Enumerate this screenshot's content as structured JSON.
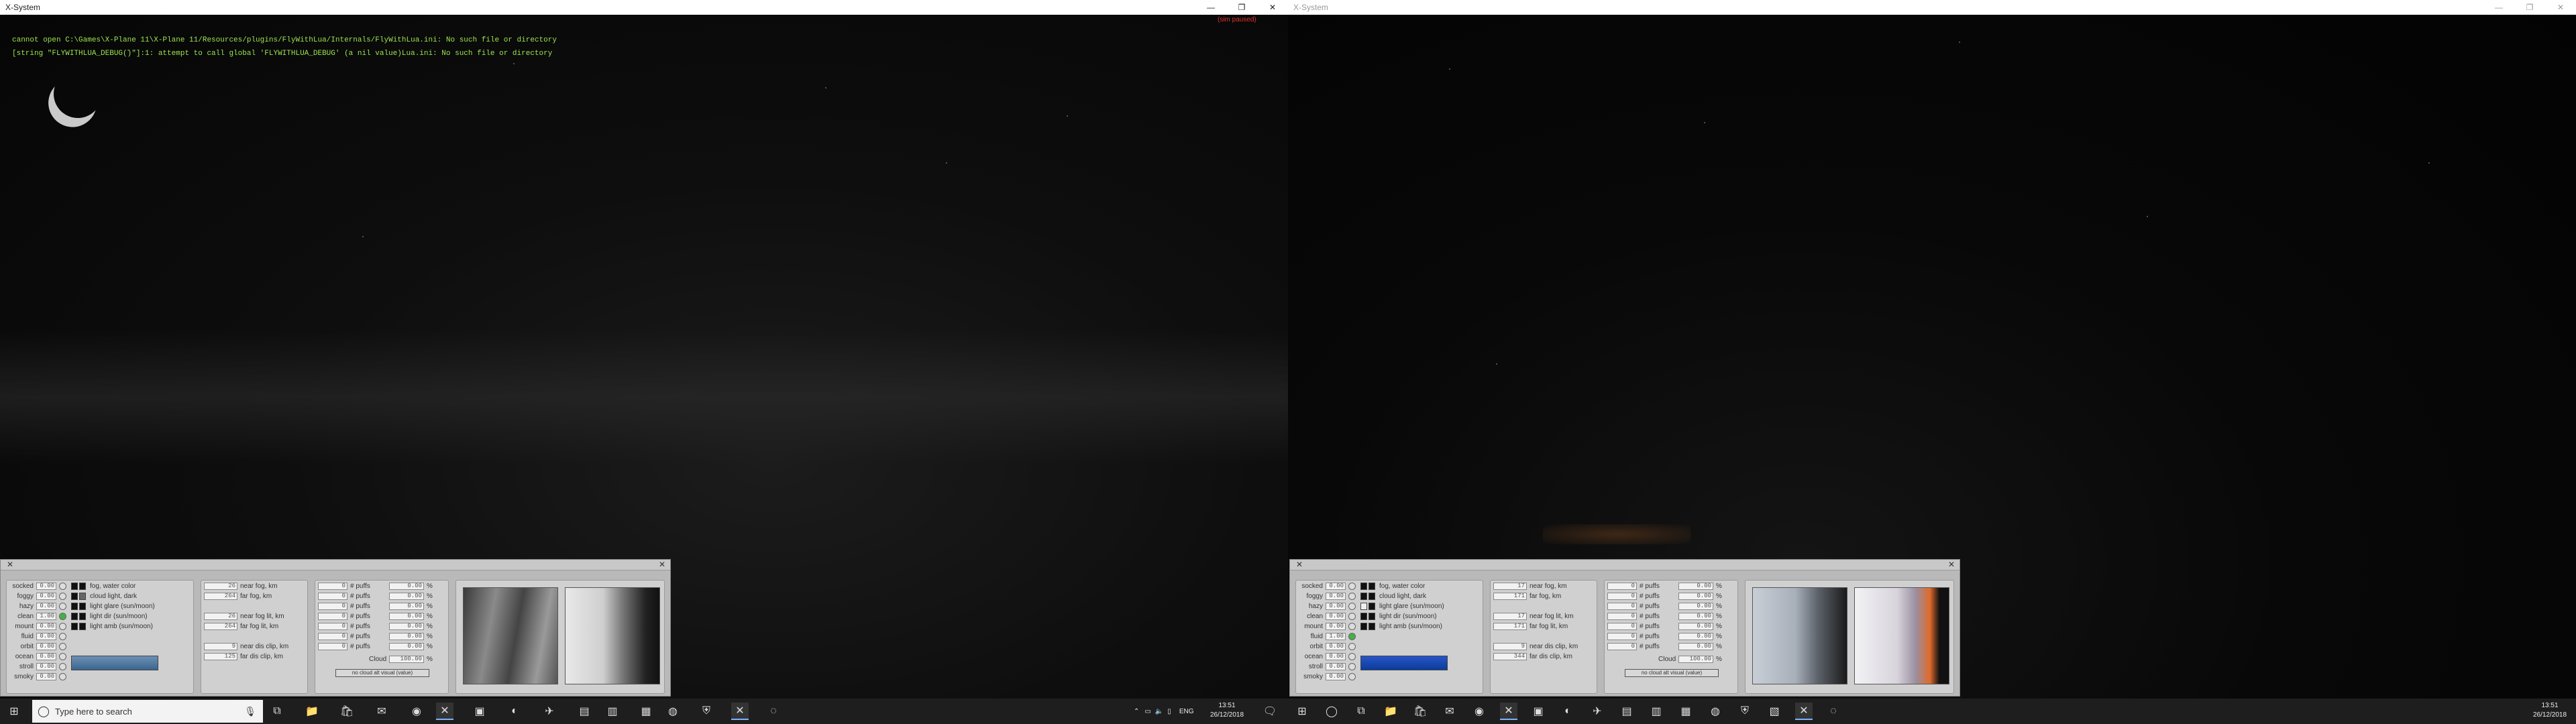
{
  "left_window": {
    "title": "X-System",
    "controls": [
      "—",
      "❐",
      "✕"
    ],
    "console_lines": [
      "cannot open C:\\Games\\X-Plane 11\\X-Plane 11/Resources/plugins/FlyWithLua/Internals/FlyWithLua.ini: No such file or directory",
      "[string \"FLYWITHLUA_DEBUG()\"]:1: attempt to call global 'FLYWITHLUA_DEBUG' (a nil value)Lua.ini: No such file or directory"
    ],
    "paused_text": "(sim paused)",
    "panel": {
      "weather_labels": [
        "socked",
        "foggy",
        "hazy",
        "clean",
        "mount",
        "fluid",
        "orbit",
        "ocean",
        "stroll",
        "smoky"
      ],
      "weather_values": [
        "0.00",
        "0.00",
        "0.00",
        "1.00",
        "0.00",
        "0.00",
        "0.00",
        "0.00",
        "0.00",
        "0.00"
      ],
      "color_labels": [
        "fog, water color",
        "cloud light, dark",
        "light glare (sun/moon)",
        "light dir (sun/moon)",
        "light amb (sun/moon)"
      ],
      "fog_values": [
        "26",
        "264",
        "",
        "26",
        "264",
        "",
        "9",
        "125"
      ],
      "fog_labels": [
        "near fog, km",
        "far fog, km",
        "",
        "near fog lit, km",
        "far fog lit, km",
        "",
        "near dis clip, km",
        "far dis clip, km"
      ],
      "puff_values": [
        "0",
        "0",
        "0",
        "0",
        "0",
        "0",
        "0"
      ],
      "puff_pct": [
        "0.00",
        "0.00",
        "0.00",
        "0.00",
        "0.00",
        "0.00",
        "0.00"
      ],
      "puff_label": "# puffs",
      "pct_sign": "%",
      "cloud_label": "Cloud",
      "cloud_value": "100.00",
      "button_label": "no cloud alt visual (value)"
    }
  },
  "right_window": {
    "title": "X-System",
    "controls": [
      "—",
      "❐",
      "✕"
    ],
    "panel": {
      "weather_labels": [
        "socked",
        "foggy",
        "hazy",
        "clean",
        "mount",
        "fluid",
        "orbit",
        "ocean",
        "stroll",
        "smoky"
      ],
      "weather_values": [
        "0.00",
        "0.00",
        "0.00",
        "0.00",
        "0.00",
        "1.00",
        "0.00",
        "0.00",
        "0.00",
        "0.00"
      ],
      "color_labels": [
        "fog, water color",
        "cloud light, dark",
        "light glare (sun/moon)",
        "light dir (sun/moon)",
        "light amb (sun/moon)"
      ],
      "fog_values": [
        "17",
        "171",
        "",
        "17",
        "171",
        "",
        "9",
        "344"
      ],
      "fog_labels": [
        "near fog, km",
        "far fog, km",
        "",
        "near fog lit, km",
        "far fog lit, km",
        "",
        "near dis clip, km",
        "far dis clip, km"
      ],
      "puff_values": [
        "0",
        "0",
        "0",
        "0",
        "0",
        "0",
        "0"
      ],
      "puff_pct": [
        "0.00",
        "0.00",
        "0.00",
        "0.00",
        "0.00",
        "0.00",
        "0.00"
      ],
      "puff_label": "# puffs",
      "pct_sign": "%",
      "cloud_label": "Cloud",
      "cloud_value": "100.00",
      "button_label": "no cloud alt visual (value)"
    }
  },
  "taskbar_left": {
    "search_placeholder": "Type here to search",
    "language": "ENG",
    "time": "13:51",
    "date": "26/12/2018"
  },
  "taskbar_right": {
    "time": "13:51",
    "date": "26/12/2018"
  },
  "colors": {
    "console_text": "#9be54f",
    "paused_text": "#e03030",
    "panel_bg": "#b9b9b9",
    "taskbar_bg": "#1e1e1e"
  }
}
